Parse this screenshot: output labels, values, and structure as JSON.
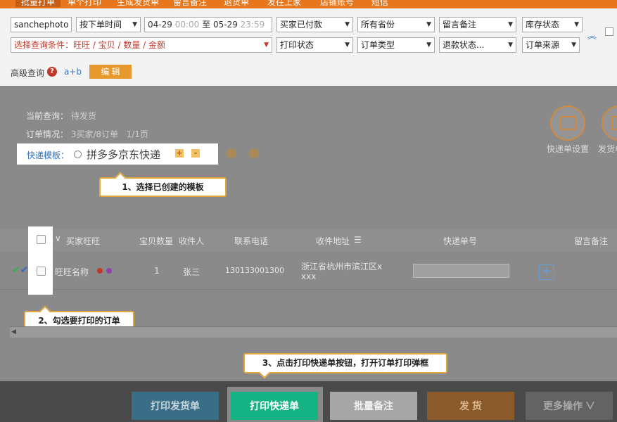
{
  "tabs": [
    "批量打单",
    "单个打印",
    "生成发货单",
    "留言备注",
    "退货单",
    "发往上家",
    "店铺账号",
    "短信"
  ],
  "filters": {
    "shop": "sanchephoto",
    "time_type": "按下单时间",
    "date_start": "04-29",
    "date_start_time": "00:00",
    "date_sep": "至",
    "date_end": "05-29",
    "date_end_time": "23:59",
    "pay_status": "买家已付款",
    "province": "所有省份",
    "remark": "留言备注",
    "stock": "库存状态",
    "query_cond": "选择查询条件：旺旺 / 宝贝 / 数量 / 金额",
    "print_status": "打印状态",
    "order_type": "订单类型",
    "refund_status": "退款状态...",
    "order_source": "订单来源",
    "arrow": "▼",
    "collapse_icon": "︽",
    "adv_label": "高级查询",
    "help": "?",
    "adv_value": "a+b",
    "edit": "编 辑"
  },
  "info": {
    "current_query_label": "当前查询：",
    "current_query_value": "待发货",
    "order_info_label": "订单情况：",
    "order_info_value": "3买家/8订单",
    "page_info": "1/1页"
  },
  "template": {
    "label": "快递模板：",
    "option": "拼多多京东快递",
    "add": "+",
    "remove": "-"
  },
  "side_buttons": {
    "waybill_settings": "快递单设置",
    "ship_settings": "发货单"
  },
  "callouts": {
    "step1": "1、选择已创建的模板",
    "step2": "2、勾选要打印的订单",
    "step3": "3、点击打印快递单按钮，打开订单打印弹框"
  },
  "table": {
    "headers": {
      "buyer": "买家旺旺",
      "qty": "宝贝数量",
      "receiver": "收件人",
      "phone": "联系电话",
      "address": "收件地址",
      "waybill": "快递单号",
      "remark": "留言备注"
    },
    "row": {
      "checks": "✔✔",
      "buyer": "旺旺名称",
      "qty": "1",
      "receiver": "张三",
      "phone": "130133001300",
      "address_line1": "浙江省杭州市滨江区x",
      "address_line2": "xxx",
      "add": "+"
    }
  },
  "bottom": {
    "print_invoice": "打印发货单",
    "print_waybill": "打印快递单",
    "batch_remark": "批量备注",
    "ship": "发 货",
    "more": "更多操作",
    "more_caret": "∨"
  },
  "colors": {
    "accent": "#e8761d",
    "print_green": "#15b384",
    "callout_border": "#e2a73c"
  }
}
